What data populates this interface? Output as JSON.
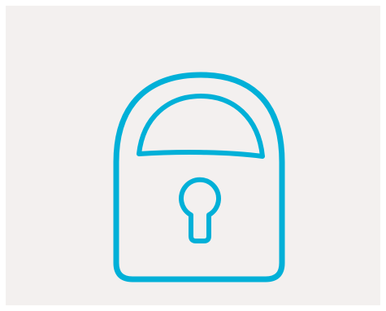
{
  "canvas": {
    "background": "#f3f0ef"
  },
  "icon": {
    "name": "padlock-icon",
    "stroke_color": "#00b0d8"
  }
}
